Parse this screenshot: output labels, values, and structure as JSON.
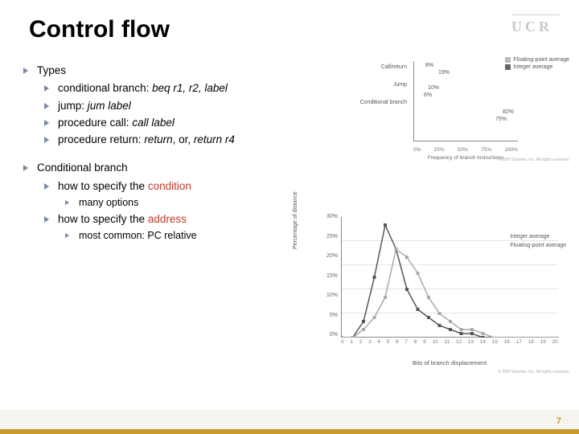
{
  "title": "Control flow",
  "logo": "UCR",
  "page_number": "7",
  "bullets": {
    "types": {
      "label": "Types",
      "items": [
        {
          "prefix": "conditional branch: ",
          "code": "beq r1, r2, label"
        },
        {
          "prefix": "jump: ",
          "code": "jum label"
        },
        {
          "prefix": "procedure call: ",
          "code": "call label"
        },
        {
          "prefix": "procedure return: ",
          "code": "return",
          ",": ", or, ",
          "code2": "return r4"
        }
      ]
    },
    "cond": {
      "label": "Conditional branch",
      "sub1": {
        "a": "how to specify the ",
        "b": "condition"
      },
      "sub1_detail": "many options",
      "sub2": {
        "a": "how to specify the ",
        "b": "address"
      },
      "sub2_detail": "most common: PC relative"
    }
  },
  "chart1": {
    "legend": [
      "Floating-point average",
      "Integer average"
    ],
    "categories": [
      "Call/return",
      "Jump",
      "Conditional branch"
    ],
    "xlabel": "Frequency of branch instructions",
    "xticks": [
      "0%",
      "25%",
      "50%",
      "75%",
      "100%"
    ],
    "copyright": "© 2007 Elsevier, Inc. All rights reserved."
  },
  "chart2": {
    "ylabel": "Percentage of distance",
    "xlabel": "Bits of branch displacement",
    "yticks": [
      "30%",
      "25%",
      "20%",
      "15%",
      "10%",
      "5%",
      "0%"
    ],
    "xticks": [
      "0",
      "1",
      "2",
      "3",
      "4",
      "5",
      "6",
      "7",
      "8",
      "9",
      "10",
      "11",
      "12",
      "13",
      "14",
      "15",
      "16",
      "17",
      "18",
      "19",
      "20"
    ],
    "legend": [
      "Integer average",
      "Floating-point average"
    ],
    "copyright": "© 2007 Elsevier, Inc. All rights reserved."
  },
  "chart_data": [
    {
      "type": "bar",
      "orientation": "horizontal",
      "title": "",
      "categories": [
        "Call/return",
        "Jump",
        "Conditional branch"
      ],
      "series": [
        {
          "name": "Floating-point average",
          "values": [
            8,
            10,
            82
          ]
        },
        {
          "name": "Integer average",
          "values": [
            19,
            6,
            75
          ]
        }
      ],
      "xlabel": "Frequency of branch instructions",
      "ylabel": "",
      "xlim": [
        0,
        100
      ],
      "value_labels": {
        "Call/return": [
          "8%",
          "19%"
        ],
        "Jump": [
          "10%",
          "6%"
        ],
        "Conditional branch": [
          "82%",
          "75%"
        ]
      }
    },
    {
      "type": "line",
      "title": "",
      "x": [
        0,
        1,
        2,
        3,
        4,
        5,
        6,
        7,
        8,
        9,
        10,
        11,
        12,
        13,
        14,
        15,
        16,
        17,
        18,
        19,
        20
      ],
      "series": [
        {
          "name": "Integer average",
          "values": [
            0,
            0,
            4,
            15,
            28,
            22,
            12,
            7,
            5,
            3,
            2,
            1,
            1,
            0,
            0,
            0,
            0,
            0,
            0,
            0,
            0
          ]
        },
        {
          "name": "Floating-point average",
          "values": [
            0,
            0,
            2,
            5,
            10,
            22,
            20,
            16,
            10,
            6,
            4,
            2,
            2,
            1,
            0,
            0,
            0,
            0,
            0,
            0,
            0
          ]
        }
      ],
      "xlabel": "Bits of branch displacement",
      "ylabel": "Percentage of distance",
      "ylim": [
        0,
        30
      ],
      "xlim": [
        0,
        20
      ]
    }
  ]
}
